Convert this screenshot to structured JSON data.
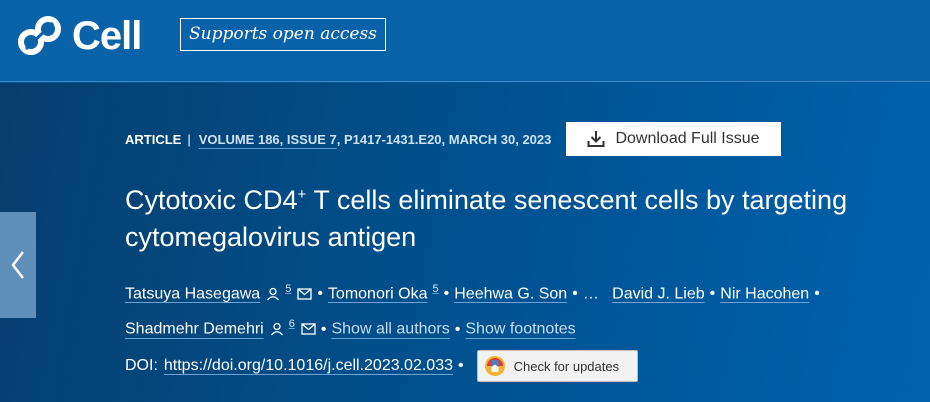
{
  "header": {
    "logo_text": "Cell",
    "badge_label": "Supports open access"
  },
  "article_meta": {
    "type": "ARTICLE",
    "separator": "|",
    "volume_issue": "VOLUME 186, ISSUE 7",
    "pages_date": ", P1417-1431.E20, MARCH 30, 2023"
  },
  "download_button": {
    "label": "Download Full Issue",
    "icon": "download-icon"
  },
  "title": {
    "part1": "Cytotoxic CD4",
    "sup": "+",
    "part2": " T cells eliminate senescent cells by targeting cytomegalovirus antigen"
  },
  "authors": [
    {
      "name": "Tatsuya Hasegawa",
      "footnote": "5",
      "icons": [
        "person-icon",
        "mail-icon"
      ]
    },
    {
      "name": "Tomonori Oka",
      "footnote": "5"
    },
    {
      "name": "Heehwa G. Son"
    },
    {
      "name": "David J. Lieb"
    },
    {
      "name": "Nir Hacohen"
    },
    {
      "name": "Shadmehr Demehri",
      "footnote": "6",
      "icons": [
        "person-icon",
        "mail-icon"
      ]
    }
  ],
  "authors_ellipsis": "…",
  "links": {
    "show_all_authors": "Show all authors",
    "show_footnotes": "Show footnotes"
  },
  "doi": {
    "label": "DOI:",
    "url": "https://doi.org/10.1016/j.cell.2023.02.033"
  },
  "check_updates": {
    "label": "Check for updates",
    "icon": "crossmark-icon"
  },
  "colors": {
    "background": "#00589a",
    "header": "#0a63a8",
    "link_underline": "#6aa3d6"
  }
}
